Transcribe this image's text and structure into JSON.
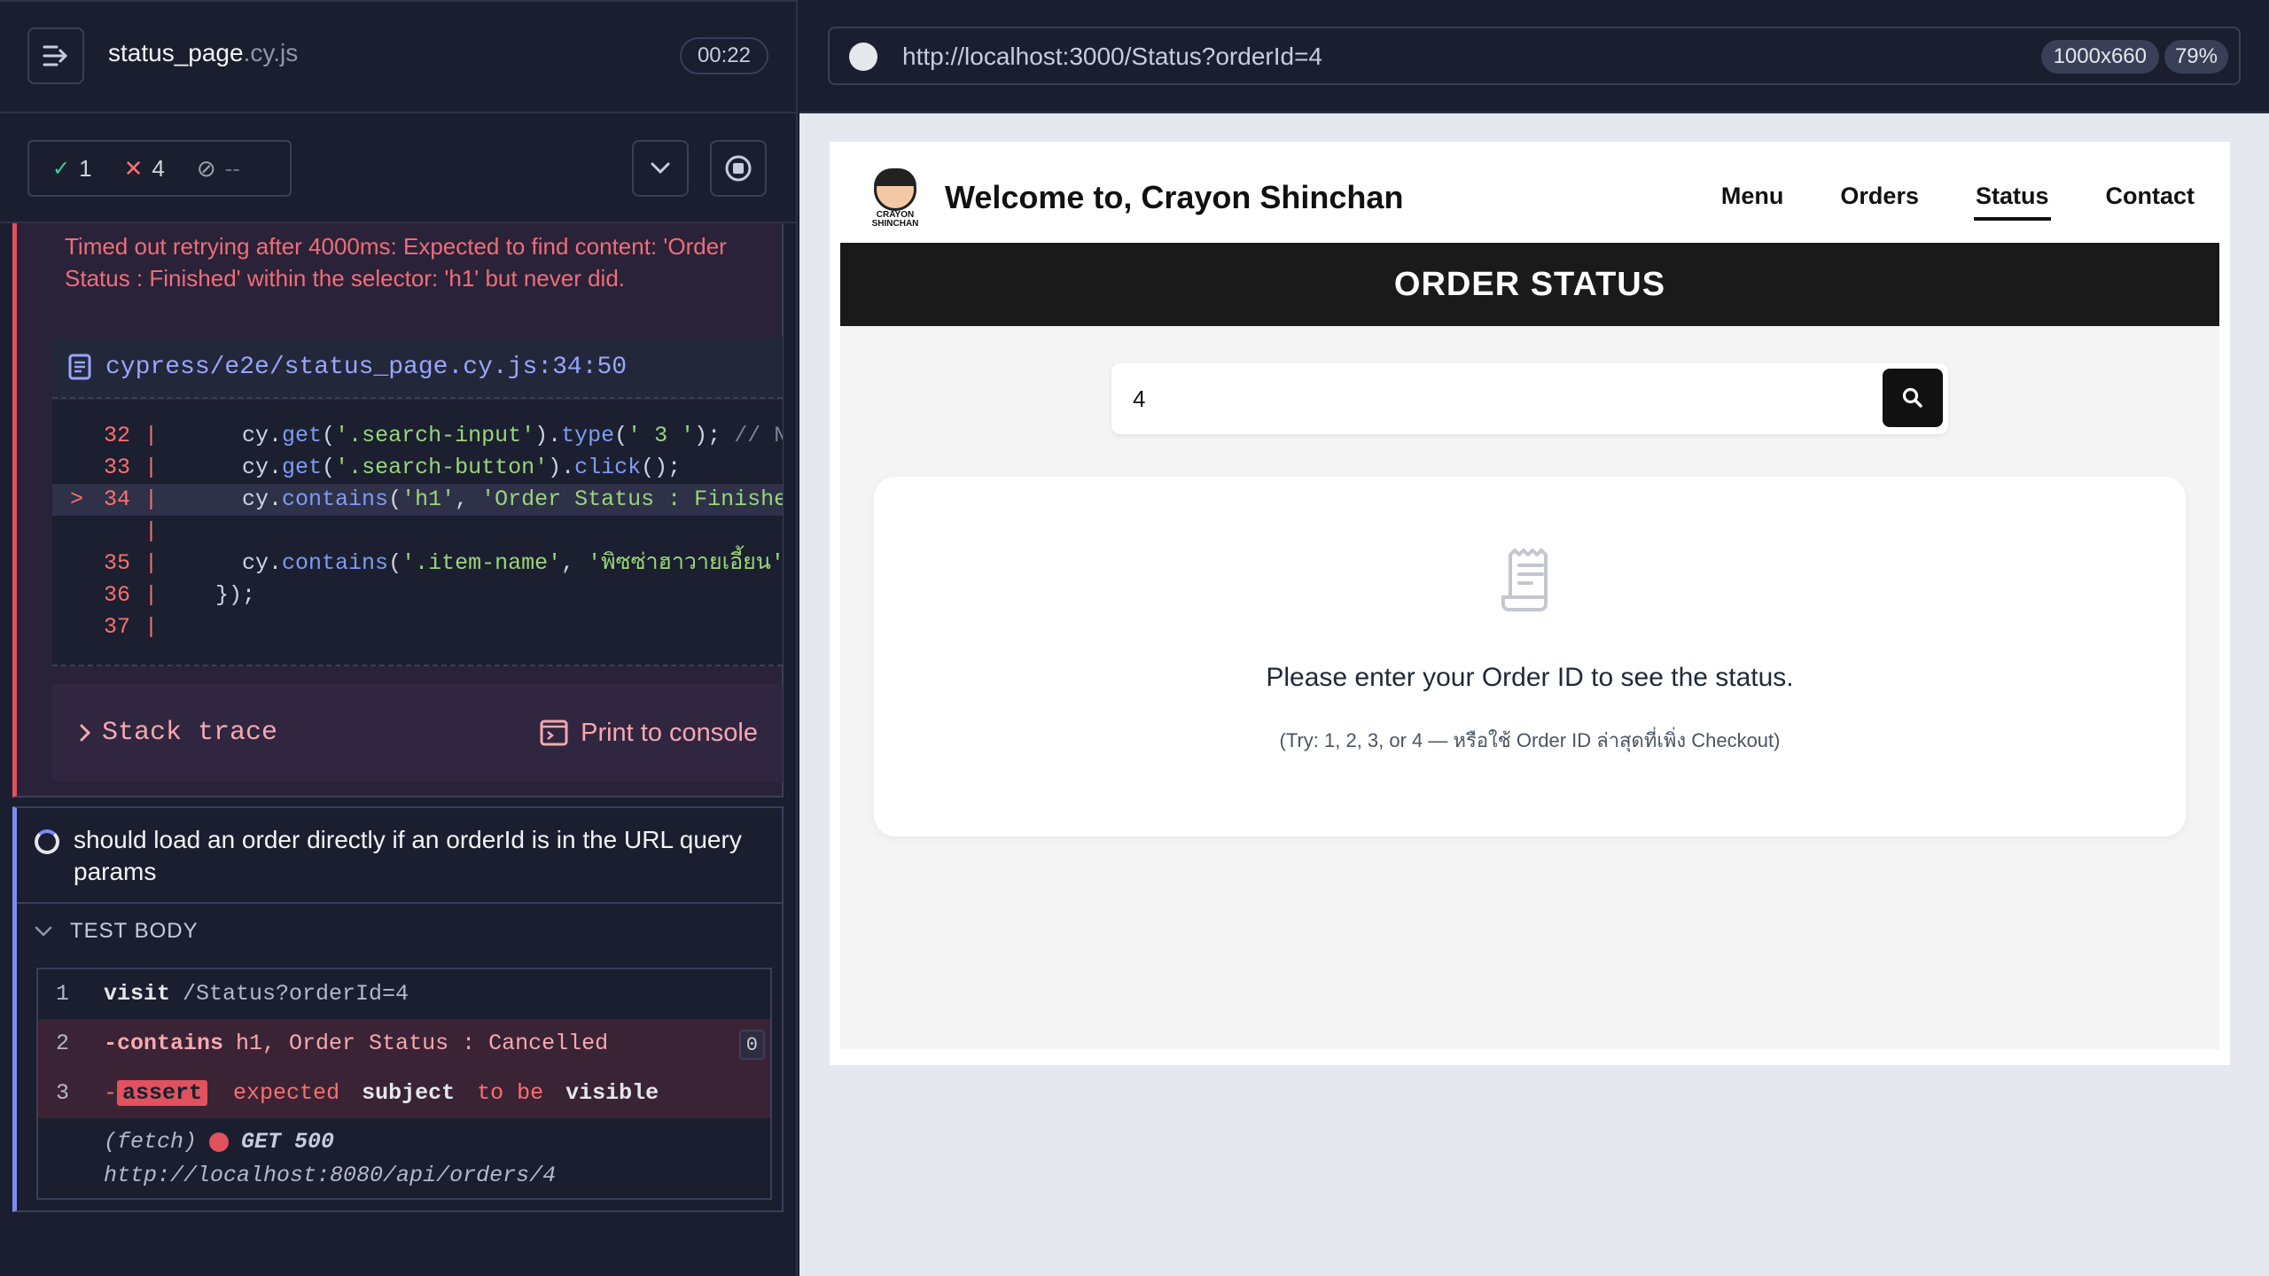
{
  "reporter": {
    "spec_name": "status_page",
    "spec_ext": ".cy.js",
    "timer": "00:22",
    "stats": {
      "passed": "1",
      "failed": "4",
      "pending": "--"
    },
    "error": {
      "message": "Timed out retrying after 4000ms: Expected to find content: 'Order Status : Finished' within the selector: 'h1' but never did.",
      "file": "cypress/e2e/status_page.cy.js:34:50",
      "code_lines": [
        {
          "ln": "32",
          "arrow": "",
          "src_parts": [
            [
              "    cy.",
              ""
            ],
            [
              "get",
              "m"
            ],
            [
              "(",
              ""
            ],
            [
              "'.search-input'",
              "s"
            ],
            [
              ").",
              ""
            ],
            [
              "type",
              "m"
            ],
            [
              "(",
              ""
            ],
            [
              "' 3 '",
              "s"
            ],
            [
              "); ",
              ""
            ],
            [
              "// N",
              "c"
            ]
          ]
        },
        {
          "ln": "33",
          "arrow": "",
          "src_parts": [
            [
              "    cy.",
              ""
            ],
            [
              "get",
              "m"
            ],
            [
              "(",
              ""
            ],
            [
              "'.search-button'",
              "s"
            ],
            [
              ").",
              ""
            ],
            [
              "click",
              "m"
            ],
            [
              "();",
              ""
            ]
          ]
        },
        {
          "ln": "34",
          "arrow": ">",
          "src_parts": [
            [
              "    cy.",
              ""
            ],
            [
              "contains",
              "m"
            ],
            [
              "(",
              ""
            ],
            [
              "'h1'",
              "s"
            ],
            [
              ", ",
              ""
            ],
            [
              "'Order Status : Finishe",
              "s"
            ]
          ]
        },
        {
          "ln": "",
          "arrow": "",
          "src_parts": []
        },
        {
          "ln": "35",
          "arrow": "",
          "src_parts": [
            [
              "    cy.",
              ""
            ],
            [
              "contains",
              "m"
            ],
            [
              "(",
              ""
            ],
            [
              "'.item-name'",
              "s"
            ],
            [
              ", ",
              ""
            ],
            [
              "'พิซซ่าฮาวายเอี้ยน'",
              "s"
            ]
          ]
        },
        {
          "ln": "36",
          "arrow": "",
          "src_parts": [
            [
              "  });",
              ""
            ]
          ]
        },
        {
          "ln": "37",
          "arrow": "",
          "src_parts": []
        }
      ],
      "stack_trace_label": "Stack trace",
      "print_console_label": "Print to console"
    },
    "test2": {
      "title": "should load an order directly if an orderId is in the URL query params",
      "test_body_label": "TEST BODY",
      "commands": [
        {
          "num": "1",
          "name": "visit",
          "msg": "/Status?orderId=4"
        },
        {
          "num": "2",
          "name": "-contains",
          "msg": "h1, Order Status : Cancelled",
          "count": "0"
        },
        {
          "num": "3",
          "dash": "-",
          "badge": "assert",
          "w1": "expected",
          "w2": "subject",
          "w3": "to be",
          "w4": "visible"
        }
      ],
      "fetch": {
        "label": "(fetch)",
        "status": "GET 500",
        "url": "http://localhost:8080/api/orders/4"
      }
    }
  },
  "browser": {
    "url": "http://localhost:3000/Status?orderId=4",
    "viewport": "1000x660",
    "zoom": "79%"
  },
  "app": {
    "logo_text": "CRAYON SHINCHAN",
    "brand": "Welcome to, Crayon Shinchan",
    "nav": [
      "Menu",
      "Orders",
      "Status",
      "Contact"
    ],
    "active_nav": "Status",
    "header": "ORDER STATUS",
    "search_value": "4",
    "info_main": "Please enter your Order ID to see the status.",
    "info_hint": "(Try: 1, 2, 3, or 4 — หรือใช้ Order ID ล่าสุดที่เพิ่ง Checkout)"
  }
}
